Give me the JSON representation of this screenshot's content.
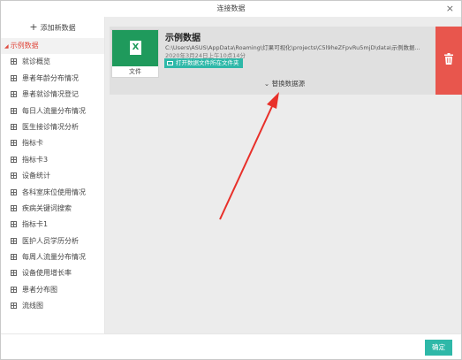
{
  "window": {
    "title": "连接数据",
    "close_label": "×"
  },
  "sidebar": {
    "add_label": "添加新数据",
    "active_item": "示例数据",
    "items": [
      "就诊概览",
      "患者年龄分布情况",
      "患者就诊情况登记",
      "每日人流量分布情况",
      "医生接诊情况分析",
      "指标卡",
      "指标卡3",
      "设备统计",
      "各科室床位使用情况",
      "疾病关键词搜索",
      "指标卡1",
      "医护人员学历分析",
      "每周人流量分布情况",
      "设备使用增长率",
      "患者分布图",
      "流线图"
    ]
  },
  "datasource": {
    "file_type": "X",
    "file_label": "文件",
    "name": "示例数据",
    "path": "C:\\Users\\ASUS\\AppData\\Roaming\\灯果可视化\\projects\\C5l9heZFpvRu5mjD\\data\\示例数据...",
    "date": "2020年3月24日上午10点14分",
    "open_folder_label": "打开数据文件所在文件夹",
    "replace_label": "替换数据源",
    "delete_icon": "trash-icon"
  },
  "footer": {
    "confirm_label": "确定"
  },
  "colors": {
    "accent": "#2eb8a8",
    "danger": "#e8564d",
    "excel": "#1f9a5c",
    "active_text": "#e04a3f",
    "annotation_arrow": "#e8302a"
  }
}
